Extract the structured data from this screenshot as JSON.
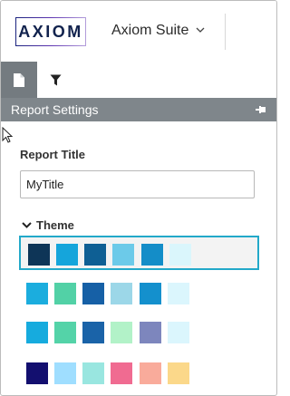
{
  "header": {
    "logo_text": "AXIOM",
    "app_name": "Axiom Suite",
    "app_menu_icon": "chevron-down-icon"
  },
  "tabs": [
    {
      "name": "document",
      "icon": "document-icon",
      "active": true
    },
    {
      "name": "filter",
      "icon": "filter-icon",
      "active": false
    }
  ],
  "panel": {
    "title": "Report Settings",
    "pin_icon": "pin-icon"
  },
  "form": {
    "title_label": "Report Title",
    "title_value": "MyTitle",
    "theme_label": "Theme"
  },
  "colors": {
    "accent": "#23a9c9",
    "header_bg": "#7f868b",
    "active_tab_bg": "#747b80"
  },
  "themes": [
    {
      "selected": true,
      "colors": [
        "#0e3557",
        "#15a5db",
        "#0e5f94",
        "#6ccae9",
        "#148dc8",
        "#daf6fc"
      ]
    },
    {
      "selected": false,
      "colors": [
        "#1badde",
        "#52d1a6",
        "#1660a6",
        "#9cd7e8",
        "#1490cd",
        "#dbf6fd"
      ]
    },
    {
      "selected": false,
      "colors": [
        "#16abde",
        "#54d3a8",
        "#1a63a8",
        "#b2f2c8",
        "#7d86bd",
        "#dbf6fd"
      ]
    },
    {
      "selected": false,
      "colors": [
        "#130f6f",
        "#9fdeff",
        "#99e6e0",
        "#f06b91",
        "#f9ab9b",
        "#fbd88a"
      ]
    }
  ]
}
